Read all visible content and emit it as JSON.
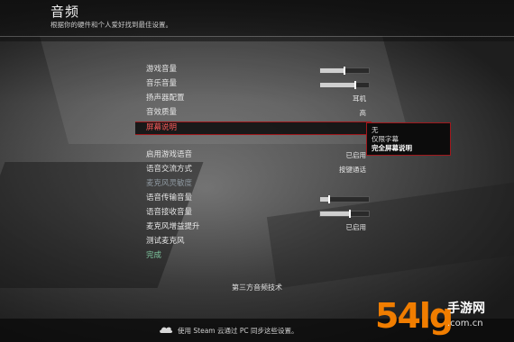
{
  "header": {
    "title": "音频",
    "subtitle": "根据你的硬件和个人爱好找到最佳设置。"
  },
  "settings": [
    {
      "label": "游戏音量",
      "kind": "slider",
      "level": 0.5
    },
    {
      "label": "音乐音量",
      "kind": "slider",
      "level": 0.72
    },
    {
      "label": "扬声器配置",
      "kind": "value",
      "value": "耳机"
    },
    {
      "label": "音效质量",
      "kind": "value",
      "value": "高"
    },
    {
      "label": "屏幕说明",
      "kind": "selected"
    },
    {
      "label": "启用游戏语音",
      "kind": "value",
      "value": "已启用"
    },
    {
      "label": "语音交流方式",
      "kind": "value",
      "value": "按键通话"
    },
    {
      "label": "麦克风灵敏度",
      "kind": "disabled"
    },
    {
      "label": "语音传输音量",
      "kind": "slider",
      "level": 0.18
    },
    {
      "label": "语音接收音量",
      "kind": "slider",
      "level": 0.62
    },
    {
      "label": "麦克风增益提升",
      "kind": "value",
      "value": "已启用"
    },
    {
      "label": "测试麦克风",
      "kind": "label"
    },
    {
      "label": "完成",
      "kind": "done"
    }
  ],
  "dropdown": {
    "options": [
      "无",
      "仅限字幕",
      "完全屏幕说明"
    ],
    "selected_index": 2
  },
  "footer": {
    "third_party": "第三方音频技术",
    "steam_note": "使用 Steam 云通过 PC 同步这些设置。"
  },
  "watermark": {
    "number": "54lg",
    "site": "手游网",
    "url": ".com.cn"
  },
  "colors": {
    "selection_border": "#a0181c",
    "selection_text": "#ff5a5a",
    "done_text": "#7fc8a0",
    "watermark_orange": "#f07d00"
  }
}
